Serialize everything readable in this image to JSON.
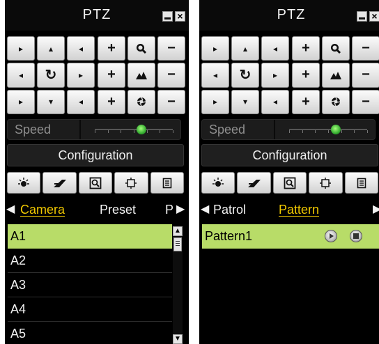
{
  "left_panel": {
    "title": "PTZ",
    "close_label": "×",
    "directional_pad": [
      "▸",
      "▴",
      "◂",
      "◂",
      "↻",
      "▸",
      "▸",
      "▾",
      "◂"
    ],
    "lens_controls": {
      "zoom": {
        "plus": "+",
        "minus": "−"
      },
      "focus": {
        "plus": "+",
        "minus": "−"
      },
      "iris": {
        "plus": "+",
        "minus": "−"
      }
    },
    "speed_label": "Speed",
    "speed_level": 0.6,
    "config_label": "Configuration",
    "function_icons": [
      "light-icon",
      "wiper-icon",
      "3d-zoom-icon",
      "image-center-icon",
      "menu-icon"
    ],
    "tabs": [
      "Camera",
      "Preset",
      "P"
    ],
    "active_tab": "Camera",
    "left_arrow": "◀",
    "right_arrow": "▶",
    "list": [
      "A1",
      "A2",
      "A3",
      "A4",
      "A5"
    ],
    "selected_index": 0
  },
  "right_panel": {
    "title": "PTZ",
    "close_label": "×",
    "directional_pad": [
      "▸",
      "▴",
      "◂",
      "◂",
      "↻",
      "▸",
      "▸",
      "▾",
      "◂"
    ],
    "lens_controls": {
      "zoom": {
        "plus": "+",
        "minus": "−"
      },
      "focus": {
        "plus": "+",
        "minus": "−"
      },
      "iris": {
        "plus": "+",
        "minus": "−"
      }
    },
    "speed_label": "Speed",
    "speed_level": 0.6,
    "config_label": "Configuration",
    "function_icons": [
      "light-icon",
      "wiper-icon",
      "3d-zoom-icon",
      "image-center-icon",
      "menu-icon"
    ],
    "tabs": [
      "Patrol",
      "Pattern"
    ],
    "active_tab": "Pattern",
    "left_arrow": "◀",
    "right_arrow": "▶",
    "list": [
      "Pattern1"
    ],
    "selected_index": 0,
    "row_actions": [
      "play-icon",
      "stop-icon"
    ]
  },
  "colors": {
    "active_tab": "#f0c800",
    "selected_row": "#b8dc68",
    "slider_knob": "#3cc23a"
  }
}
